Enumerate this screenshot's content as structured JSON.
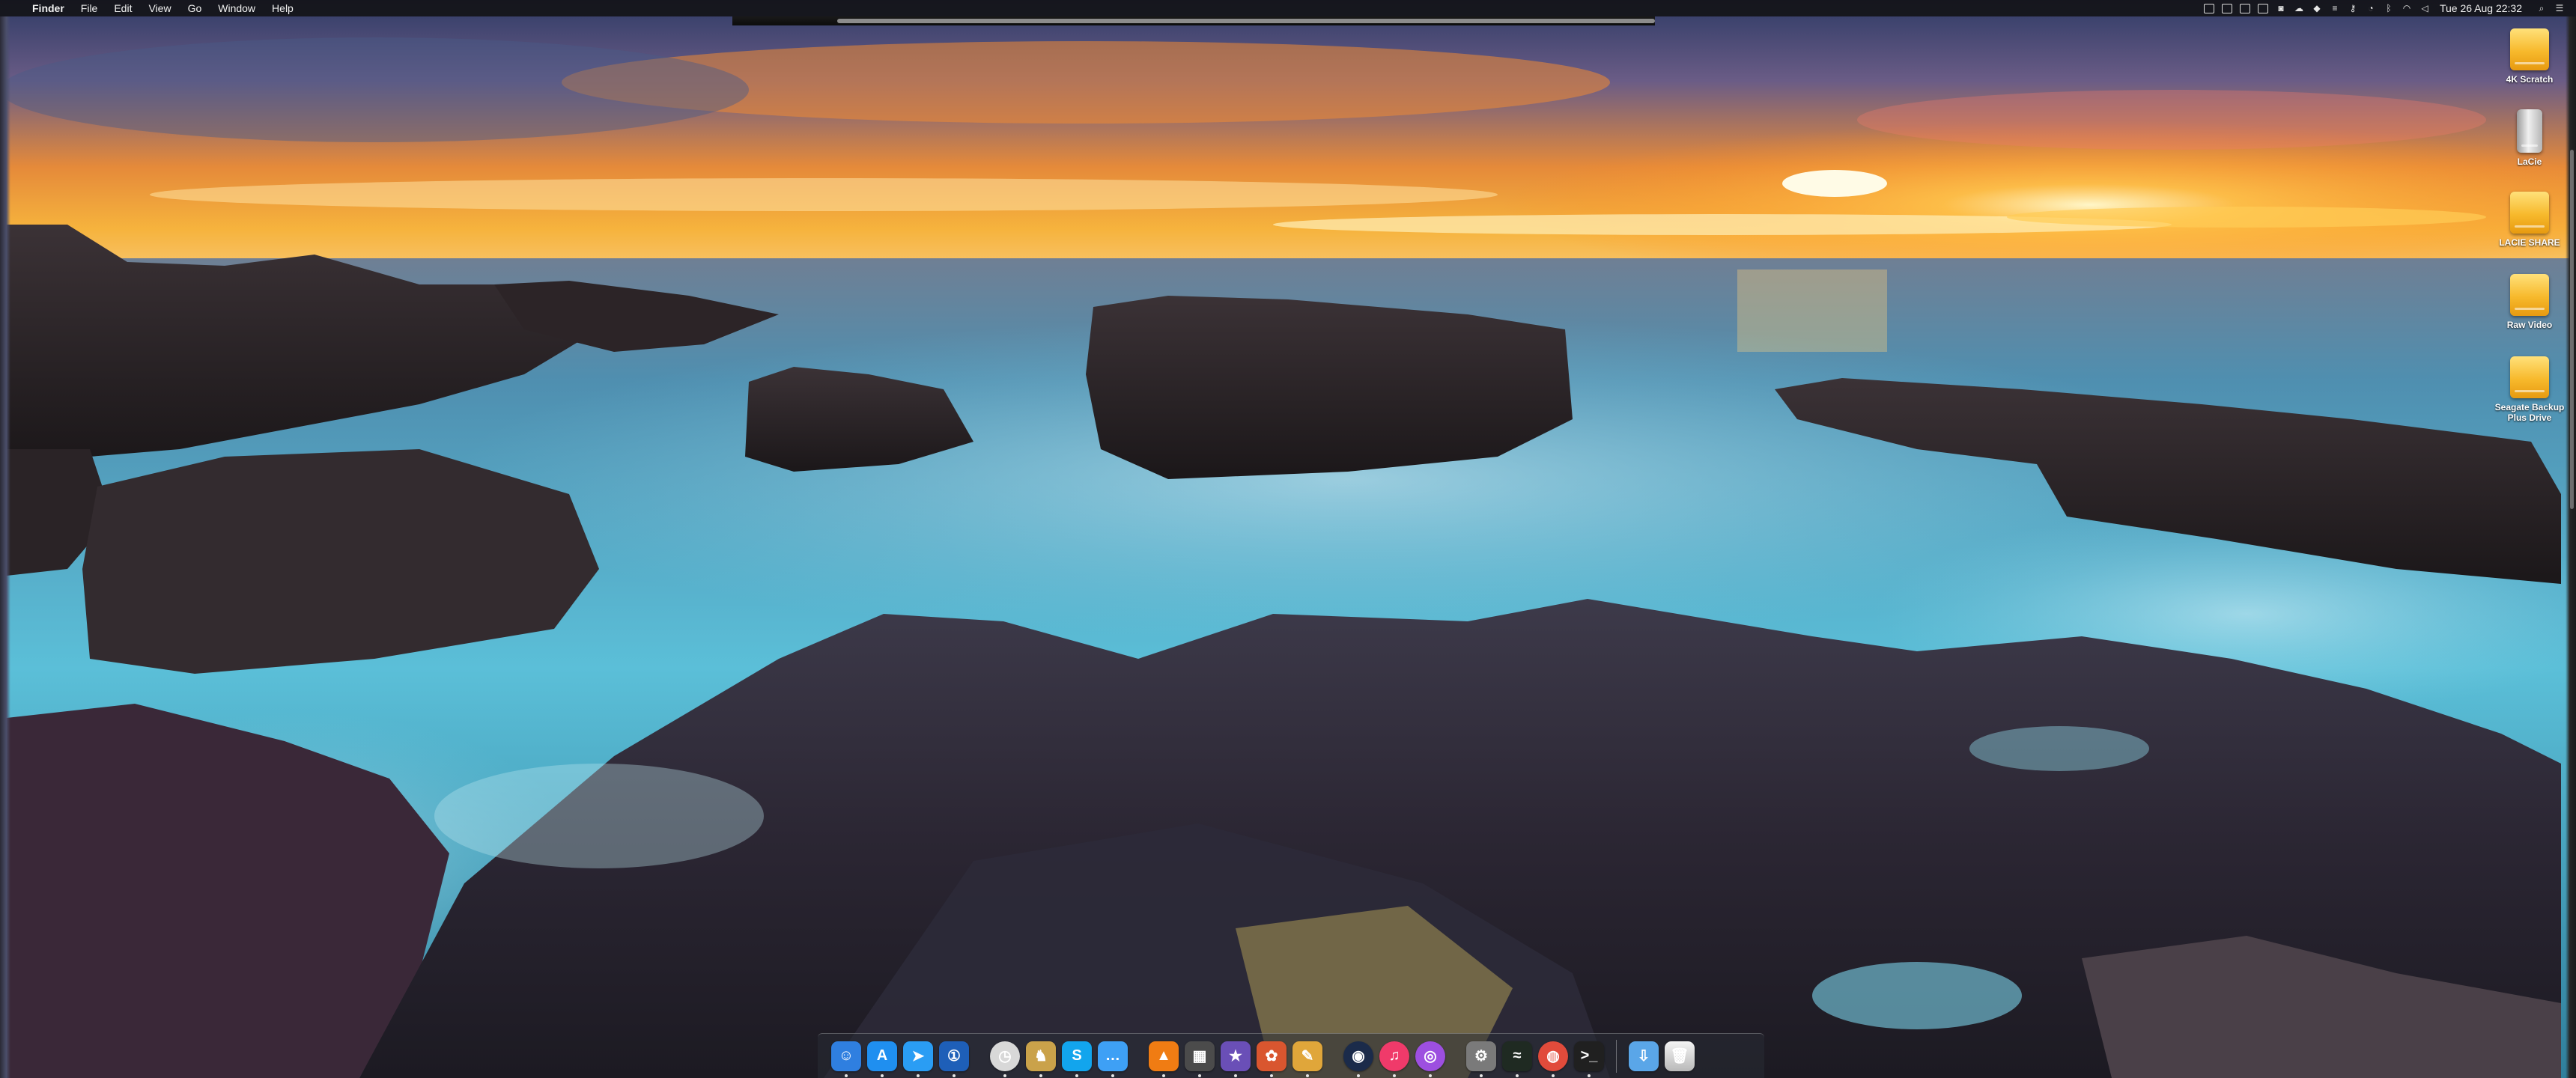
{
  "menubar": {
    "apple_glyph": "",
    "app_name": "Finder",
    "menus": [
      "File",
      "Edit",
      "View",
      "Go",
      "Window",
      "Help"
    ],
    "clock": "Tue 26 Aug  22:32"
  },
  "desktop_icons": [
    {
      "label": "4K Scratch",
      "icon": "drive-yellow-icon"
    },
    {
      "label": "LaCie",
      "icon": "drive-silver-icon"
    },
    {
      "label": "LACIE SHARE",
      "icon": "drive-yellow-icon"
    },
    {
      "label": "Raw Video",
      "icon": "drive-yellow-icon"
    },
    {
      "label": "Seagate Backup Plus Drive",
      "icon": "drive-yellow-icon"
    }
  ],
  "dock": {
    "apps": [
      {
        "name": "finder-icon",
        "glyph": "☺",
        "color": "#2f7fe0"
      },
      {
        "name": "app-store-icon",
        "glyph": "A",
        "color": "#1f8ff0"
      },
      {
        "name": "safari-icon",
        "glyph": "➤",
        "color": "#2a9df4"
      },
      {
        "name": "1password-icon",
        "glyph": "①",
        "color": "#1e5fb8"
      },
      {
        "name": "clock-icon",
        "glyph": "◷",
        "color": "#d8d8d8"
      },
      {
        "name": "cyberduck-icon",
        "glyph": "♞",
        "color": "#caa24a"
      },
      {
        "name": "skype-icon",
        "glyph": "S",
        "color": "#12a5ed"
      },
      {
        "name": "messages-icon",
        "glyph": "…",
        "color": "#3ea0f5"
      },
      {
        "name": "vlc-icon",
        "glyph": "▲",
        "color": "#f07c13"
      },
      {
        "name": "final-cut-icon",
        "glyph": "▦",
        "color": "#4b4b4b"
      },
      {
        "name": "imovie-icon",
        "glyph": "★",
        "color": "#6a4fb7"
      },
      {
        "name": "photo-app-icon",
        "glyph": "✿",
        "color": "#d9562f"
      },
      {
        "name": "scripts-icon",
        "glyph": "✎",
        "color": "#e0a63a"
      },
      {
        "name": "steam-icon",
        "glyph": "◉",
        "color": "#1b2b4a"
      },
      {
        "name": "itunes-icon",
        "glyph": "♫",
        "color": "#f03a6a"
      },
      {
        "name": "podcasts-icon",
        "glyph": "◎",
        "color": "#9d4fe0"
      },
      {
        "name": "system-preferences-icon",
        "glyph": "⚙",
        "color": "#7a7a7a"
      },
      {
        "name": "activity-monitor-icon",
        "glyph": "≈",
        "color": "#1f2a22"
      },
      {
        "name": "chrome-icon",
        "glyph": "◍",
        "color": "#e14b3b"
      },
      {
        "name": "terminal-icon",
        "glyph": ">_",
        "color": "#202020"
      }
    ],
    "stack_folder": {
      "name": "downloads-folder-icon",
      "glyph": "⇩",
      "color": "#5aa6e8"
    },
    "trash": {
      "name": "trash-icon",
      "glyph": "🗑",
      "color": "#d9d9d9"
    }
  },
  "colors": {
    "sky_top": "#3d4f80",
    "sunset_orange": "#f39a2c",
    "sun": "#fff4c2",
    "sea": "#3fa6c6",
    "rock": "#2a2326"
  }
}
